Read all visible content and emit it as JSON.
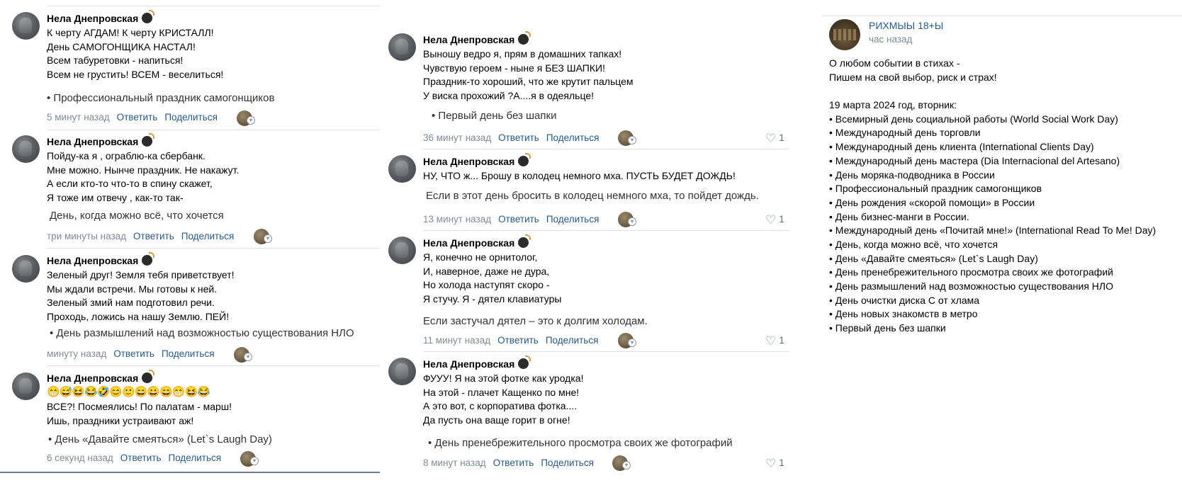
{
  "left_comments": [
    {
      "author": "Нела Днепровская",
      "lines": [
        "К черту АГДАМ! К черту КРИСТАЛЛ!",
        "День САМОГОНЩИКА НАСТАЛ!",
        "Всем табуретовки - напиться!",
        "Всем не грустить! ВСЕМ - веселиться!"
      ],
      "overlay": "• Профессиональный праздник самогонщиков",
      "time": "5 минут назад",
      "reply": "Ответить",
      "share": "Поделиться"
    },
    {
      "author": "Нела Днепровская",
      "lines": [
        "Пойду-ка я , ограблю-ка сбербанк.",
        "Мне можно. Нынче праздник. Не накажут.",
        "А если кто-то что-то в спину скажет,",
        "Я тоже им отвечу , как-то так-"
      ],
      "overlay": "День, когда можно всё, что хочется",
      "time": "три минуты назад",
      "reply": "Ответить",
      "share": "Поделиться"
    },
    {
      "author": "Нела Днепровская",
      "lines": [
        "Зеленый друг! Земля тебя приветствует!",
        "Мы ждали встречи. Мы готовы к ней.",
        "Зеленый змий нам подготовил речи.",
        "Проходь, ложись на нашу Землю. ПЕЙ!"
      ],
      "overlay": "• День размышлений над возможностью существования НЛО",
      "time": "минуту назад",
      "reply": "Ответить",
      "share": "Поделиться"
    },
    {
      "author": "Нела Днепровская",
      "emoji": "😁😅😆😂🤣😊🙂😄😀😄😁😆😂",
      "lines": [
        "ВСЕ?! Посмеялись! По палатам - марш!",
        "Ишь, праздники устраивают аж!"
      ],
      "overlay": "• День «Давайте смеяться» (Let`s Laugh Day)",
      "time": "6 секунд назад",
      "reply": "Ответить",
      "share": "Поделиться"
    }
  ],
  "mid_comments": [
    {
      "author": "Нела Днепровская",
      "lines": [
        "Выношу ведро я, прям в домашних тапках!",
        "Чувствую героем - ныне я БЕЗ ШАПКИ!",
        "Праздник-то хороший, что же крутит пальцем",
        "У виска прохожий ?А....я в одеяльце!"
      ],
      "overlay": "• Первый день без шапки",
      "time": "36 минут назад",
      "reply": "Ответить",
      "share": "Поделиться",
      "likes": "1"
    },
    {
      "author": "Нела Днепровская",
      "lines": [
        "НУ, ЧТО ж... Брошу в колодец немного мха. ПУСТЬ БУДЕТ ДОЖДЬ!"
      ],
      "overlay": "Если в этот день бросить в колодец немного мха, то пойдет дождь.",
      "time": "13 минут назад",
      "reply": "Ответить",
      "share": "Поделиться",
      "likes": "1"
    },
    {
      "author": "Нела Днепровская",
      "lines": [
        "Я, конечно не орнитолог,",
        "И, наверное, даже не дура,",
        "Но холода наступят скоро -",
        "Я стучу. Я - дятел клавиатуры"
      ],
      "overlay": "Если застучал дятел – это к долгим холодам.",
      "time": "11 минут назад",
      "reply": "Ответить",
      "share": "Поделиться",
      "likes": "1"
    },
    {
      "author": "Нела Днепровская",
      "lines": [
        "ФУУУ! Я на этой фотке как уродка!",
        "На этой - плачет Кащенко по мне!",
        "А это вот, с корпоратива фотка....",
        "Да пусть она ваще горит в огне!"
      ],
      "overlay": "• День пренебрежительного просмотра своих же фотографий",
      "time": "8 минут назад",
      "reply": "Ответить",
      "share": "Поделиться",
      "likes": "1"
    }
  ],
  "post": {
    "name": "РИХМЫЫ 18+Ы",
    "time": "час назад",
    "lines": [
      "О любом событии в стихах -",
      "Пишем на свой выбор, риск и страх!",
      "",
      "19 марта 2024 год, вторник:",
      "• Всемирный день социальной работы (World Social Work Day)",
      "• Международный день торговли",
      "• Международный день клиента (International Clients Day)",
      "• Международный день мастера (Dia Internacional del Artesano)",
      "• День моряка-подводника в России",
      "• Профессиональный праздник самогонщиков",
      "• День рождения «скорой помощи» в России",
      "• День бизнес-манги в России.",
      "• Международный день «Почитай мне!» (International Read To Me! Day)",
      "• День, когда можно всё, что хочется",
      "• День «Давайте смеяться» (Let`s Laugh Day)",
      "• День пренебрежительного просмотра своих же фотографий",
      "• День размышлений над возможностью существования НЛО",
      "• День очистки диска С от хлама",
      "• День новых знакомств в метро",
      "• Первый день без шапки"
    ]
  },
  "colors": {
    "link": "#2a5885",
    "meta": "#818c99",
    "separator": "#dce1e6"
  }
}
